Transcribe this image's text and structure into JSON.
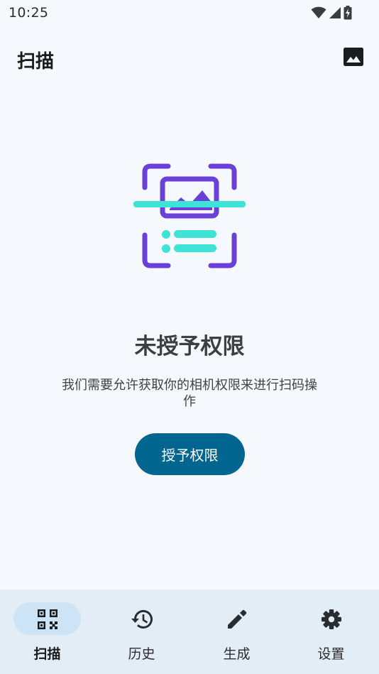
{
  "status_bar": {
    "time": "10:25"
  },
  "app_bar": {
    "title": "扫描",
    "gallery_icon": "image-icon"
  },
  "permission": {
    "title": "未授予权限",
    "description": "我们需要允许获取你的相机权限来进行扫码操作",
    "button_label": "授予权限"
  },
  "illustration": {
    "frame_color": "#6b40d6",
    "accent_color": "#3de3d6"
  },
  "bottom_nav": {
    "active_index": 0,
    "items": [
      {
        "label": "扫描",
        "icon": "qr-code-icon"
      },
      {
        "label": "历史",
        "icon": "history-icon"
      },
      {
        "label": "生成",
        "icon": "pencil-icon"
      },
      {
        "label": "设置",
        "icon": "gear-icon"
      }
    ]
  },
  "colors": {
    "background": "#f5f9fe",
    "primary_button": "#00658f",
    "nav_background": "#e3edf6",
    "nav_indicator": "#cde4f6"
  }
}
